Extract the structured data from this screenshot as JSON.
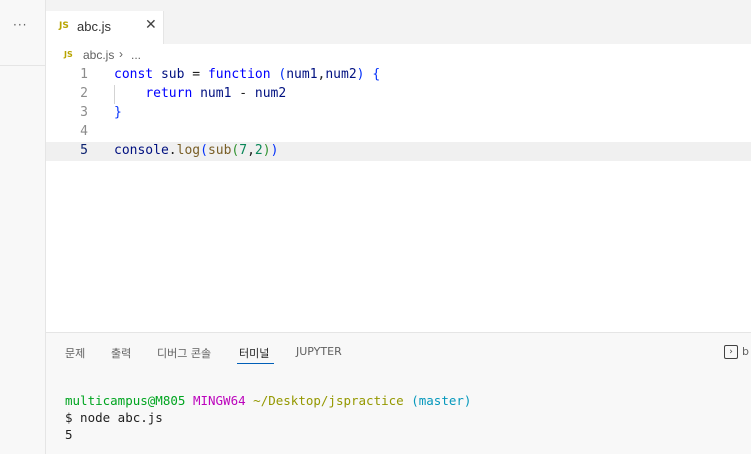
{
  "sidebar": {
    "more_label": "···"
  },
  "tab": {
    "lang_badge": "JS",
    "filename": "abc.js",
    "close": "✕"
  },
  "breadcrumb": {
    "lang_badge": "JS",
    "file": "abc.js",
    "separator": "›",
    "more": "..."
  },
  "editor": {
    "line_numbers": [
      "1",
      "2",
      "3",
      "4",
      "5"
    ],
    "active_line": "5",
    "lines": [
      [
        {
          "t": "const",
          "c": "kw"
        },
        {
          "t": " "
        },
        {
          "t": "sub",
          "c": "var"
        },
        {
          "t": " = "
        },
        {
          "t": "function",
          "c": "kw"
        },
        {
          "t": " "
        },
        {
          "t": "(",
          "c": "br1"
        },
        {
          "t": "num1",
          "c": "var"
        },
        {
          "t": ","
        },
        {
          "t": "num2",
          "c": "var"
        },
        {
          "t": ")",
          "c": "br1"
        },
        {
          "t": " "
        },
        {
          "t": "{",
          "c": "br1"
        }
      ],
      [
        {
          "t": "    "
        },
        {
          "t": "return",
          "c": "kw"
        },
        {
          "t": " "
        },
        {
          "t": "num1",
          "c": "var"
        },
        {
          "t": " - "
        },
        {
          "t": "num2",
          "c": "var"
        }
      ],
      [
        {
          "t": "}",
          "c": "br1"
        }
      ],
      [],
      [
        {
          "t": "console",
          "c": "var"
        },
        {
          "t": "."
        },
        {
          "t": "log",
          "c": "fn"
        },
        {
          "t": "(",
          "c": "br1"
        },
        {
          "t": "sub",
          "c": "fn"
        },
        {
          "t": "(",
          "c": "br2"
        },
        {
          "t": "7",
          "c": "num"
        },
        {
          "t": ","
        },
        {
          "t": "2",
          "c": "num"
        },
        {
          "t": ")",
          "c": "br2"
        },
        {
          "t": ")",
          "c": "br1"
        }
      ]
    ]
  },
  "panel": {
    "tabs": [
      "문제",
      "출력",
      "디버그 콘솔",
      "터미널",
      "JUPYTER"
    ],
    "active_tab": "터미널",
    "cut_label": "b"
  },
  "terminal": {
    "user_host": "multicampus@M805",
    "system": "MINGW64",
    "path": "~/Desktop/jspractice",
    "branch": "(master)",
    "command": "$ node abc.js",
    "output": "5"
  },
  "colors": {
    "accent": "#005fb8",
    "keyword": "#0000ff",
    "function": "#795e26",
    "variable": "#001080",
    "number": "#098658"
  }
}
